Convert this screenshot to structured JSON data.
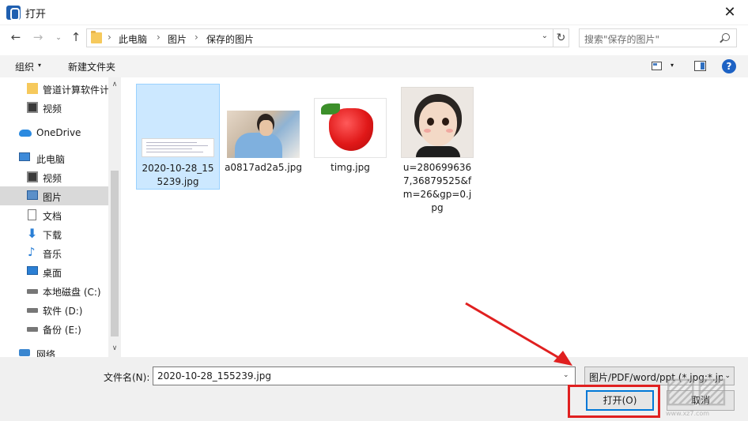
{
  "window": {
    "title": "打开",
    "close_glyph": "✕"
  },
  "nav": {
    "back_glyph": "←",
    "forward_glyph": "→",
    "recent_glyph": "⌄",
    "up_glyph": "↑",
    "breadcrumbs": [
      "此电脑",
      "图片",
      "保存的图片"
    ],
    "sep_glyph": "›",
    "dropdown_glyph": "⌄",
    "refresh_glyph": "↻",
    "search_placeholder": "搜索\"保存的图片\""
  },
  "toolbar": {
    "organize_label": "组织",
    "organize_arrow": "▾",
    "new_folder_label": "新建文件夹",
    "view_arrow": "▾",
    "help_glyph": "?"
  },
  "sidebar": {
    "items": [
      {
        "label": "管道计算软件计",
        "icon": "folder-icon"
      },
      {
        "label": "视频",
        "icon": "video-icon"
      },
      {
        "label": "OneDrive",
        "icon": "cloud-icon"
      },
      {
        "label": "此电脑",
        "icon": "pc-icon"
      },
      {
        "label": "视频",
        "icon": "video-icon"
      },
      {
        "label": "图片",
        "icon": "pictures-icon",
        "selected": true
      },
      {
        "label": "文档",
        "icon": "document-icon"
      },
      {
        "label": "下载",
        "icon": "download-icon",
        "glyph": "⬇"
      },
      {
        "label": "音乐",
        "icon": "music-icon",
        "glyph": "♪"
      },
      {
        "label": "桌面",
        "icon": "desktop-icon"
      },
      {
        "label": "本地磁盘 (C:)",
        "icon": "disk-icon"
      },
      {
        "label": "软件 (D:)",
        "icon": "disk-icon"
      },
      {
        "label": "备份 (E:)",
        "icon": "disk-icon"
      },
      {
        "label": "网络",
        "icon": "network-icon"
      }
    ],
    "scroll_up": "∧",
    "scroll_down": "∨"
  },
  "files": [
    {
      "name": "2020-10-28_155239.jpg",
      "selected": true
    },
    {
      "name": "a0817ad2a5.jpg"
    },
    {
      "name": "timg.jpg"
    },
    {
      "name": "u=2806996367,36879525&fm=26&gp=0.jpg"
    }
  ],
  "bottom": {
    "filename_label": "文件名(N):",
    "filename_value": "2020-10-28_155239.jpg",
    "filename_dropdown": "⌄",
    "filter_value": "图片/PDF/word/ppt (*.jpg;*.jp",
    "filter_arrow": "⌄",
    "open_label": "打开(O)",
    "cancel_label": "取消"
  },
  "colors": {
    "accent": "#0078d7",
    "annotation_red": "#e02020",
    "selected_bg": "#cce8ff"
  },
  "watermark": {
    "glyph": "▨▨",
    "url": "www.xz7.com"
  }
}
